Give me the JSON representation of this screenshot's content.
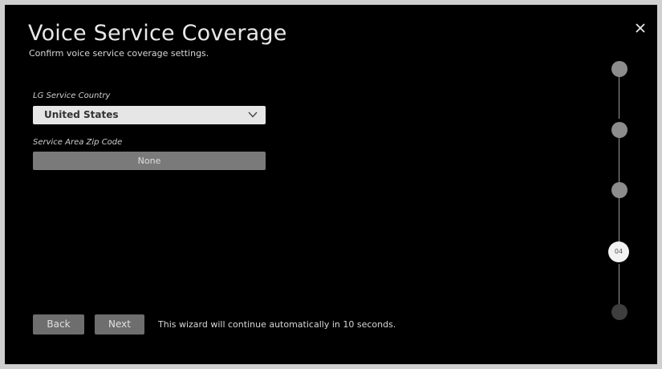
{
  "header": {
    "title": "Voice Service Coverage",
    "subtitle": "Confirm voice service coverage settings."
  },
  "icons": {
    "close": "close-icon",
    "chevron": "chevron-down-icon"
  },
  "form": {
    "country_label": "LG Service Country",
    "country_value": "United States",
    "zip_label": "Service Area Zip Code",
    "zip_value": "None"
  },
  "footer": {
    "back_label": "Back",
    "next_label": "Next",
    "auto_message": "This wizard will continue automatically in 10 seconds."
  },
  "stepper": {
    "current_step_label": "04",
    "total_steps": 5,
    "current_step": 4
  },
  "colors": {
    "background": "#000000",
    "frame": "#cfcfcf",
    "dropdown_bg": "#e6e6e6",
    "field_bg": "#7a7a7a",
    "button_bg": "#6e6e6e",
    "step_dot": "#8c8c8c"
  }
}
